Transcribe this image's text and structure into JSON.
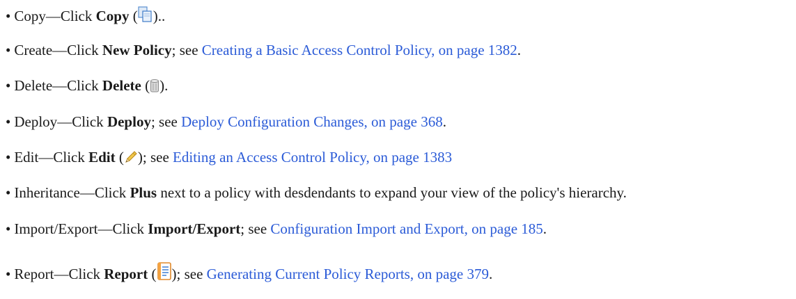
{
  "items": [
    {
      "term": "Copy",
      "sep": "—Click ",
      "bold": "Copy",
      "after_bold": "  (",
      "icon": "copy-icon",
      "after_icon": ").."
    },
    {
      "term": "Create",
      "sep": "—Click ",
      "bold": "New Policy",
      "after_bold": "; see ",
      "link": "Creating a Basic Access Control Policy, on page 1382",
      "tail": "."
    },
    {
      "term": "Delete",
      "sep": "—Click ",
      "bold": "Delete",
      "after_bold": " (",
      "icon": "trash-icon",
      "after_icon": ")."
    },
    {
      "term": "Deploy",
      "sep": "—Click ",
      "bold": "Deploy",
      "after_bold": "; see ",
      "link": "Deploy Configuration Changes, on page 368",
      "tail": "."
    },
    {
      "term": "Edit",
      "sep": "—Click ",
      "bold": "Edit",
      "after_bold": " (",
      "icon": "pencil-icon",
      "after_icon": "); see ",
      "link": "Editing an Access Control Policy, on page 1383"
    },
    {
      "term": "Inheritance",
      "sep": "—Click ",
      "bold": "Plus",
      "after_bold": " next to a policy with desdendants to expand your view of the policy's hierarchy."
    },
    {
      "term": "Import/Export",
      "sep": "—Click ",
      "bold": "Import/Export",
      "after_bold": "; see ",
      "link": "Configuration Import and Export, on page 185",
      "tail": "."
    },
    {
      "term": "Report",
      "sep": "—Click ",
      "bold": "Report",
      "after_bold": " (",
      "icon": "report-icon",
      "after_icon": "); see ",
      "link": "Generating Current Policy Reports, on page 379",
      "tail": "."
    }
  ],
  "bullet": "•",
  "colors": {
    "link": "#2b5bd7",
    "text": "#1a1a1a"
  }
}
